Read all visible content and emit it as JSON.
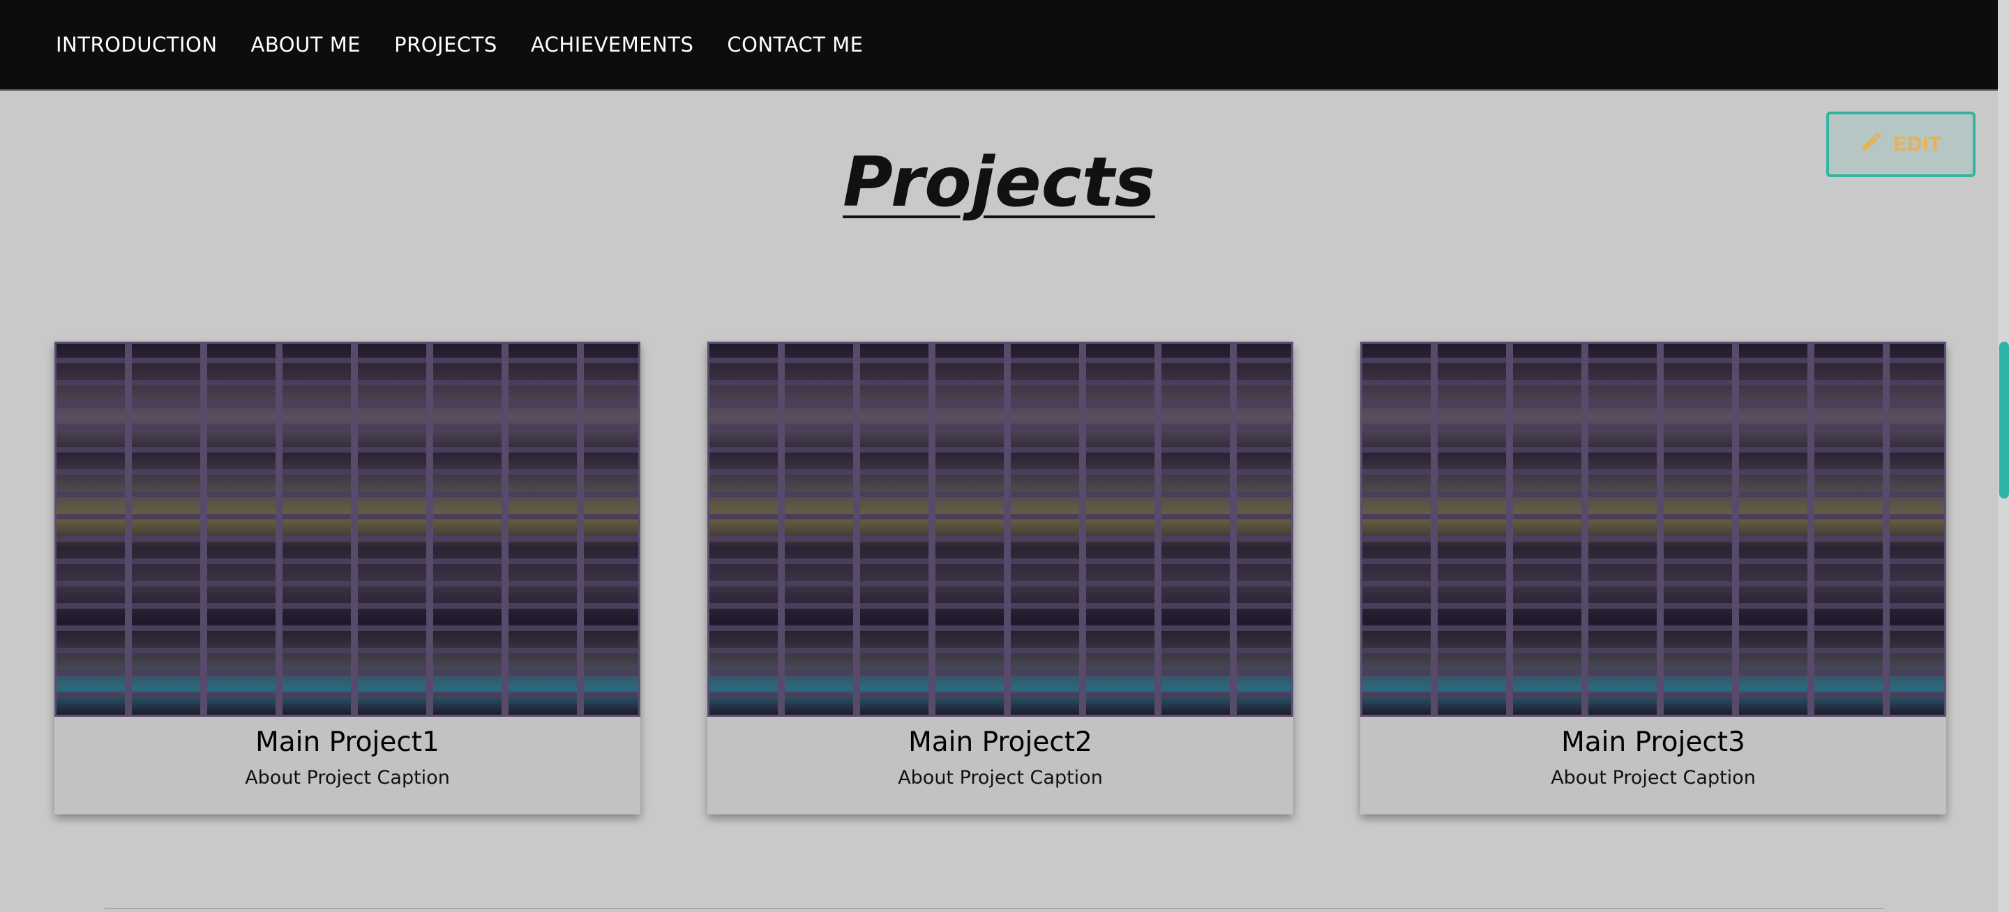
{
  "nav": {
    "items": [
      {
        "label": "INTRODUCTION"
      },
      {
        "label": "ABOUT ME"
      },
      {
        "label": "PROJECTS"
      },
      {
        "label": "ACHIEVEMENTS"
      },
      {
        "label": "CONTACT ME"
      }
    ]
  },
  "edit_button": {
    "label": "EDIT",
    "icon": "pencil-icon"
  },
  "page": {
    "title": "Projects"
  },
  "projects": [
    {
      "title": "Main Project1",
      "caption": "About Project Caption"
    },
    {
      "title": "Main Project2",
      "caption": "About Project Caption"
    },
    {
      "title": "Main Project3",
      "caption": "About Project Caption"
    }
  ],
  "colors": {
    "navbar_bg": "#0d0d0d",
    "page_bg": "#c9c9c9",
    "accent": "#2ab3a6",
    "edit_text": "#e9b24a"
  }
}
